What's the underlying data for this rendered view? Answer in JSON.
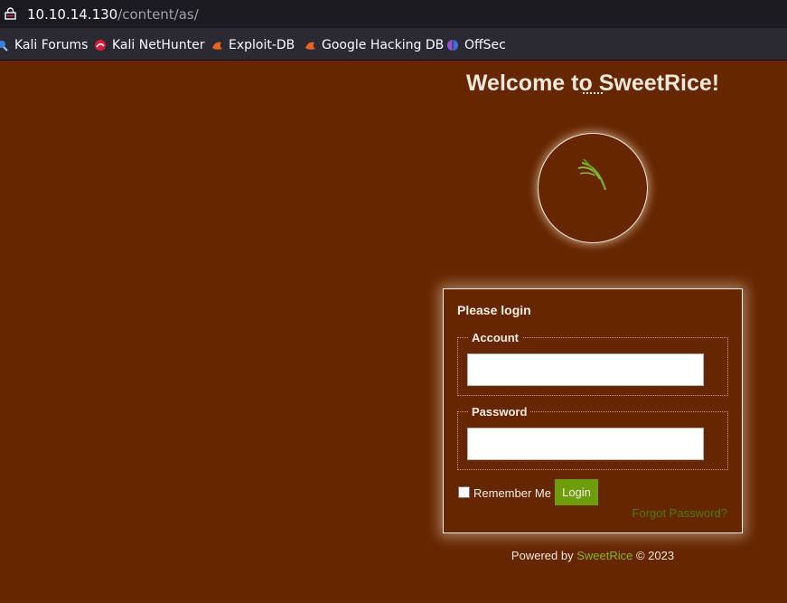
{
  "browser": {
    "url_host": "10.10.14.130",
    "url_path": "/content/as/"
  },
  "bookmarks": [
    {
      "label": "Kali Forums",
      "icon": "kali-forums-icon"
    },
    {
      "label": "Kali NetHunter",
      "icon": "kali-nethunter-icon"
    },
    {
      "label": "Exploit-DB",
      "icon": "exploit-db-icon"
    },
    {
      "label": "Google Hacking DB",
      "icon": "google-hacking-db-icon"
    },
    {
      "label": "OffSec",
      "icon": "offsec-icon"
    }
  ],
  "page": {
    "title": "Welcome to SweetRice!",
    "login": {
      "heading": "Please login",
      "account_label": "Account",
      "account_value": "",
      "password_label": "Password",
      "password_value": "",
      "remember_label": "Remember Me",
      "login_button": "Login",
      "forgot_link": "Forgot Password?"
    },
    "footer": {
      "prefix": "Powered by ",
      "brand": "SweetRice",
      "suffix": " © 2023"
    }
  },
  "colors": {
    "page_background": "#652600",
    "text": "#f2e8dc",
    "accent_green": "#6d9e0a",
    "link_green": "#8ab51a"
  }
}
